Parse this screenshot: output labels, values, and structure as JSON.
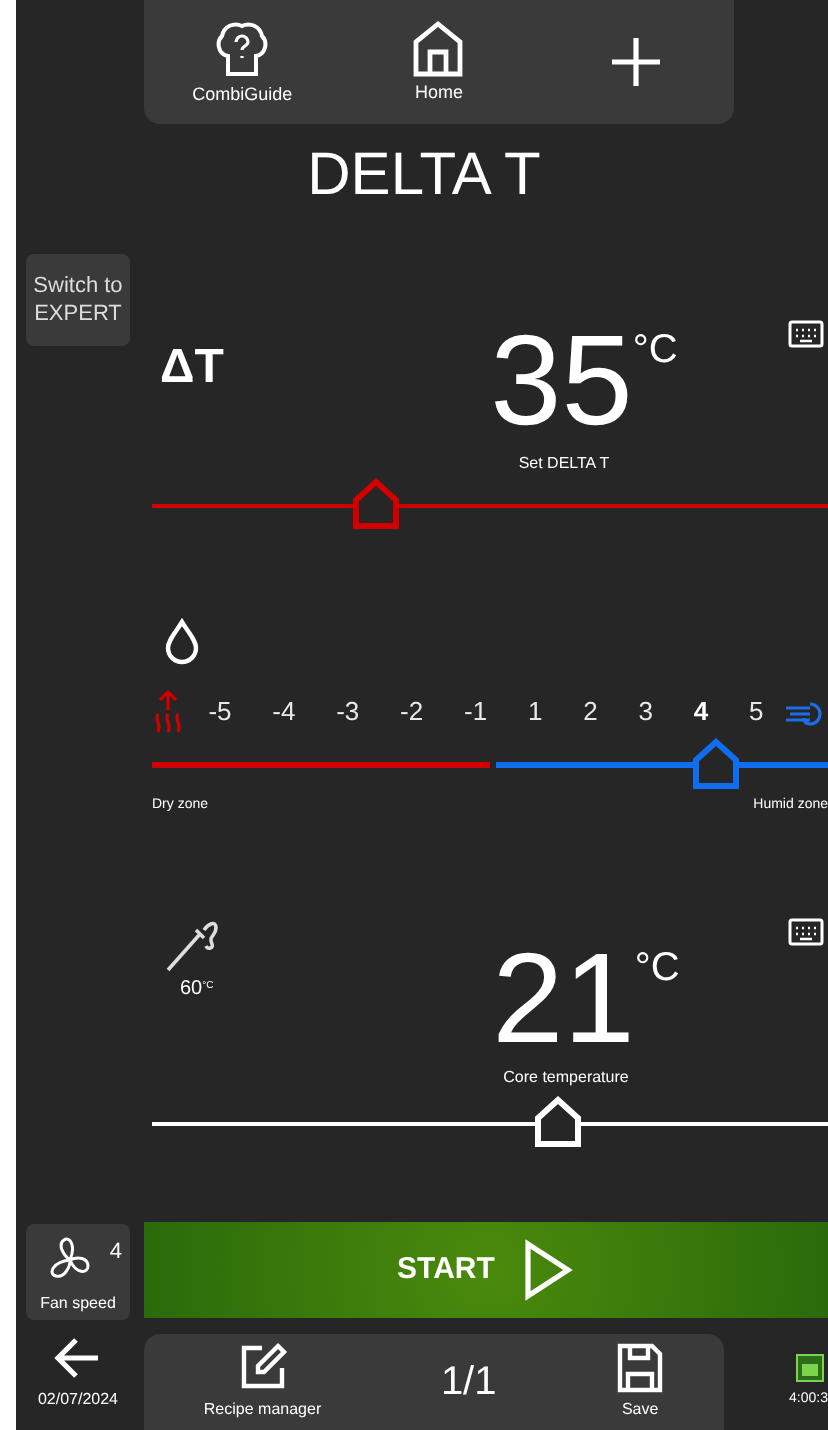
{
  "top_nav": [
    {
      "kind": "guide",
      "label": "CombiGuide"
    },
    {
      "kind": "home",
      "label": "Home"
    },
    {
      "kind": "add"
    }
  ],
  "title": "DELTA T",
  "mode_button": {
    "label": "Switch to EXPERT"
  },
  "delta_t": {
    "symbol": "ΔT",
    "value": "35",
    "unit": "°C",
    "caption": "Set DELTA T",
    "level": 0.33
  },
  "humidity": {
    "ticks": [
      {
        "label": "-5",
        "selected": false
      },
      {
        "label": "-4",
        "selected": false
      },
      {
        "label": "-3",
        "selected": false
      },
      {
        "label": "-2",
        "selected": false
      },
      {
        "label": "-1",
        "selected": false
      },
      {
        "label": "1",
        "selected": false
      },
      {
        "label": "2",
        "selected": false
      },
      {
        "label": "3",
        "selected": false
      },
      {
        "label": "4",
        "selected": true
      },
      {
        "label": "5",
        "selected": false
      }
    ],
    "left_label": "Dry zone",
    "right_label": "Humid zone"
  },
  "core": {
    "probe_value": "60",
    "probe_unit": "°C",
    "value": "21",
    "unit": "°C",
    "caption": "Core temperature",
    "level": 0.6
  },
  "fan": {
    "value": "4",
    "label": "Fan speed"
  },
  "start": {
    "label": "START"
  },
  "bottom": {
    "date": "02/07/2024",
    "recipe_label": "Recipe manager",
    "page": "1/1",
    "save_label": "Save",
    "time": "4:00:3"
  }
}
